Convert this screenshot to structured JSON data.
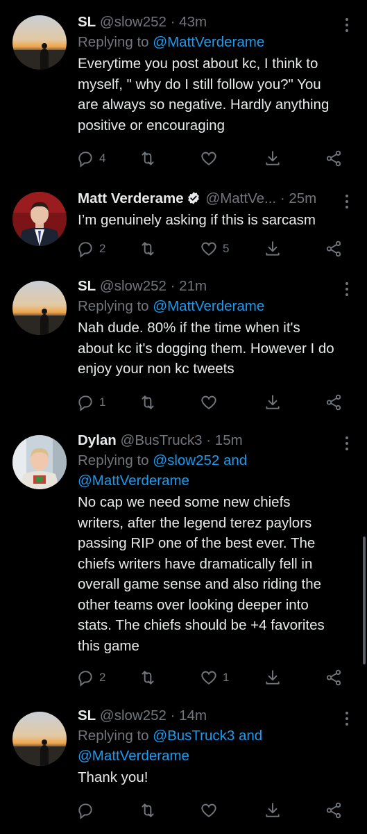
{
  "colors": {
    "background": "#000000",
    "text": "#e7e9ea",
    "muted": "#71767b",
    "link": "#1d9bf0",
    "verified": "#e7e9ea"
  },
  "tweets": [
    {
      "name": "SL",
      "handle": "@slow252",
      "time": "43m",
      "replying_prefix": "Replying to",
      "replying_to": "@MattVerderame",
      "text_lines": [
        "Everytime you post about kc, I think to",
        "myself,  \" why do I still follow you?\"  You",
        "are always so negative. Hardly anything",
        "positive or encouraging"
      ],
      "reply_count": "4",
      "retweet_count": "",
      "like_count": "",
      "avatar": "sunset-beach-avatar"
    },
    {
      "name": "Matt Verderame",
      "handle": "@MattVe...",
      "time": "25m",
      "verified": true,
      "text_lines": [
        "I’m genuinely asking if this is sarcasm"
      ],
      "reply_count": "2",
      "retweet_count": "",
      "like_count": "5",
      "avatar": "man-in-suit-avatar"
    },
    {
      "name": "SL",
      "handle": "@slow252",
      "time": "21m",
      "replying_prefix": "Replying to",
      "replying_to": "@MattVerderame",
      "text_lines": [
        "Nah dude. 80% if the time when it's",
        "about kc it's dogging them. However I do",
        "enjoy your non kc tweets"
      ],
      "reply_count": "1",
      "retweet_count": "",
      "like_count": "",
      "avatar": "sunset-beach-avatar"
    },
    {
      "name": "Dylan",
      "handle": "@BusTruck3",
      "time": "15m",
      "replying_prefix": "Replying to",
      "replying_to": "@slow252 and",
      "replying_to_2": "@MattVerderame",
      "text_lines": [
        "No cap we need some new chiefs",
        "writers, after the legend terez paylors",
        "passing RIP one of the best ever. The",
        "chiefs writers have dramatically fell in",
        "overall game sense and also riding the",
        "other teams over looking deeper into",
        "stats. The chiefs should be +4 favorites",
        "this game"
      ],
      "reply_count": "2",
      "retweet_count": "",
      "like_count": "1",
      "avatar": "boy-photo-avatar"
    },
    {
      "name": "SL",
      "handle": "@slow252",
      "time": "14m",
      "replying_prefix": "Replying to",
      "replying_to": "@BusTruck3 and",
      "replying_to_2": "@MattVerderame",
      "text_lines": [
        "Thank you!"
      ],
      "reply_count": "",
      "retweet_count": "",
      "like_count": "",
      "avatar": "sunset-beach-avatar"
    }
  ],
  "separator": "·"
}
